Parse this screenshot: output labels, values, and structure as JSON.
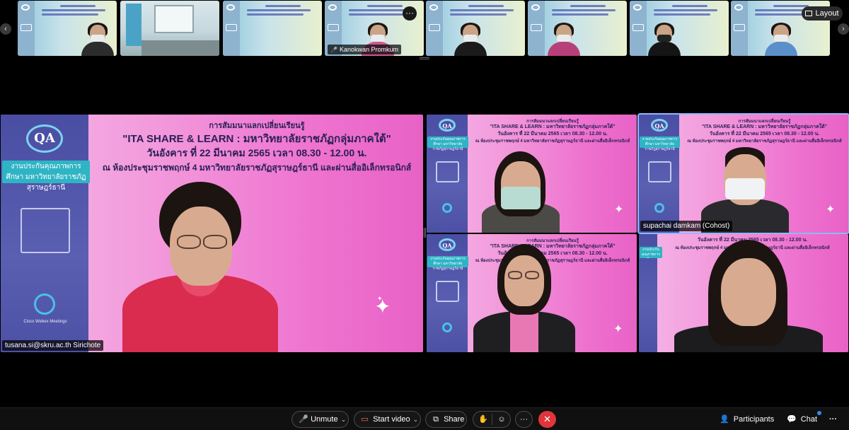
{
  "filmstrip": {
    "participant_label": "Kanokwan Promkum",
    "more_label": "···",
    "layout_label": "Layout",
    "prev_label": "‹",
    "next_label": "›"
  },
  "slide": {
    "title_small": "การสัมมนาแลกเปลี่ยนเรียนรู้",
    "title_main": "\"ITA SHARE & LEARN : มหาวิทยาลัยราชภัฏกลุ่มภาคใต้\"",
    "date_line": "วันอังคาร ที่ 22 มีนาคม 2565 เวลา 08.30 - 12.00 น.",
    "venue_line": "ณ ห้องประชุมราชพฤกษ์ 4 มหาวิทยาลัยราชภัฏสุราษฎร์ธานี และผ่านสื่ออิเล็กทรอนิกส์",
    "department": "งานประกันคุณภาพการศึกษา มหาวิทยาลัยราชภัฏสุราษฎร์ธานี",
    "logo": "QA",
    "cisco_label": "Cisco Webex Meetings"
  },
  "tiles": {
    "main_name": "tusana.si@skru.ac.th Sirichote",
    "cohost_name": "supachai damkam (Cohost)"
  },
  "toolbar": {
    "unmute": "Unmute",
    "start_video": "Start video",
    "share": "Share",
    "more": "···",
    "end": "✕",
    "participants": "Participants",
    "chat": "Chat",
    "overflow": "···"
  },
  "colors": {
    "slide_pink": "#ee72cf",
    "slide_sidebar": "#4a4ea3",
    "accent_teal": "#2fb4c5",
    "end_red": "#e0353b",
    "notification_blue": "#2b8cf0"
  }
}
